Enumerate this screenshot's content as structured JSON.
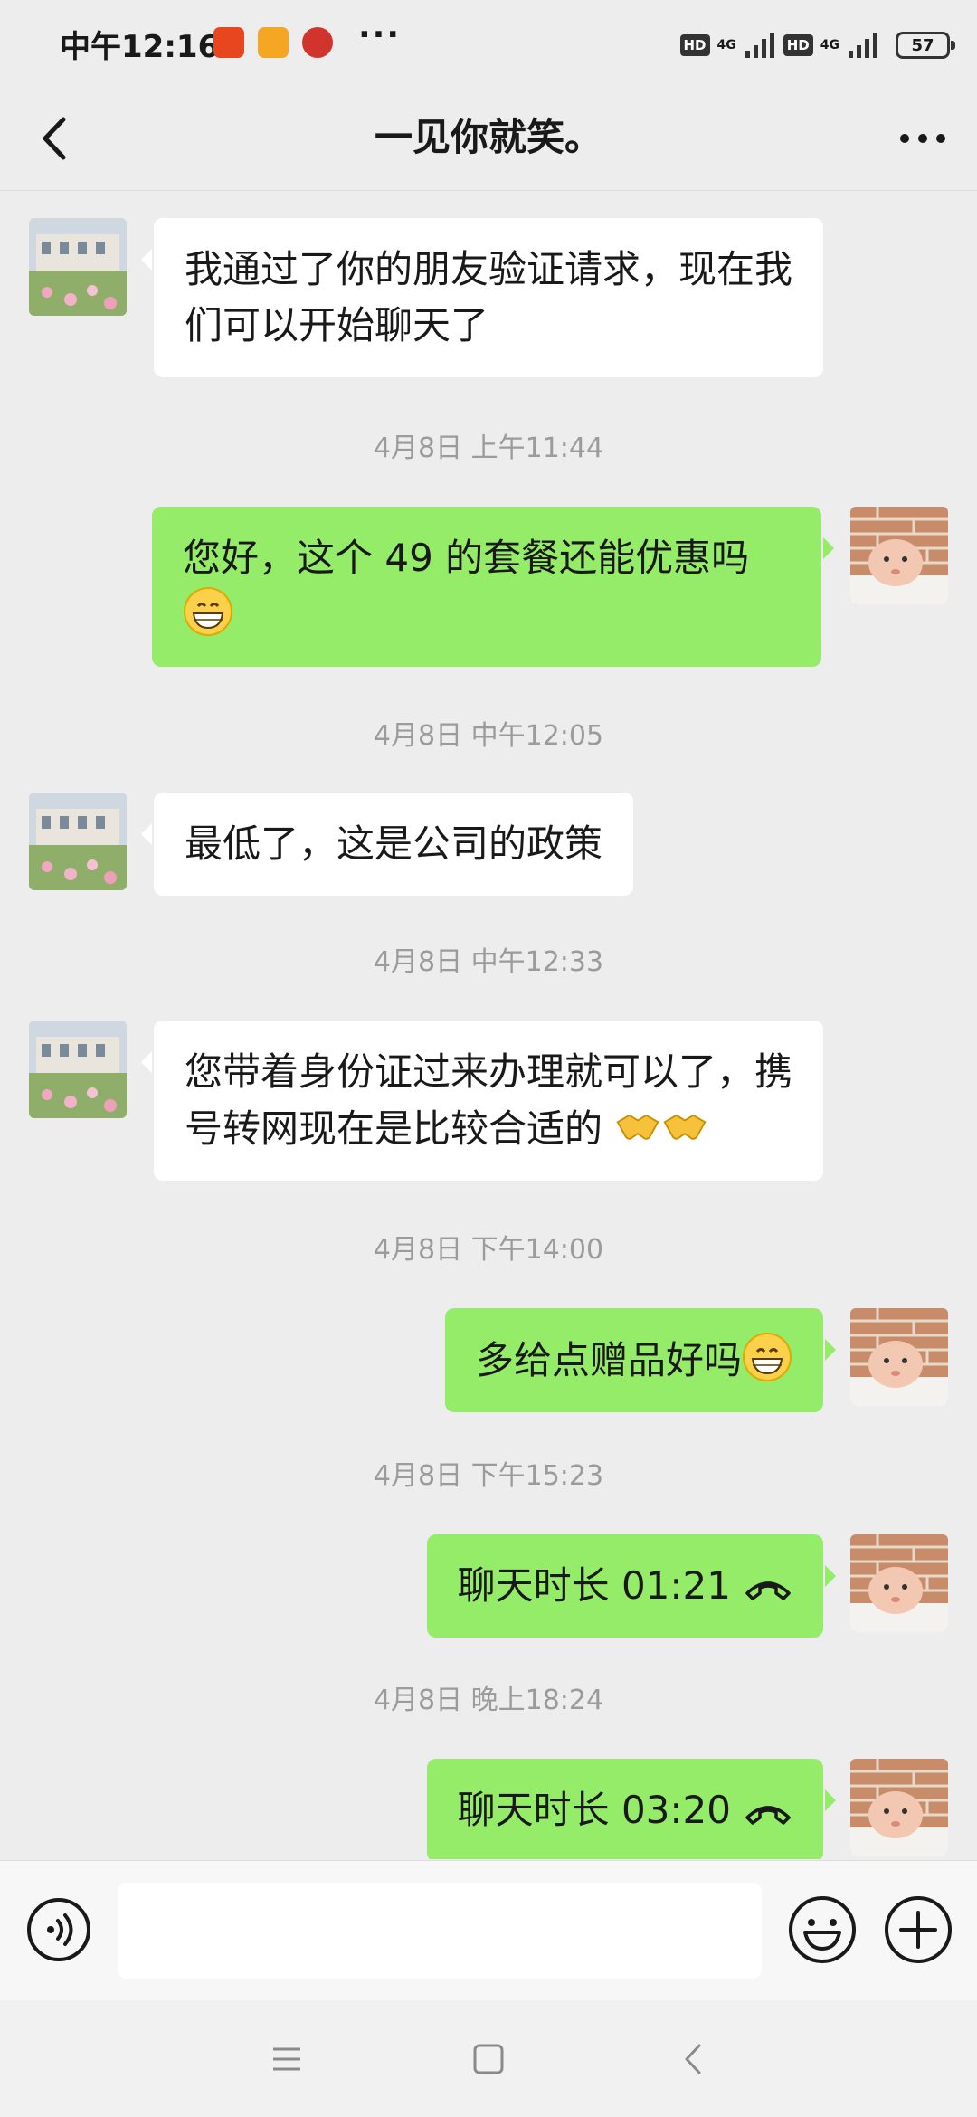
{
  "status_bar": {
    "time": "中午12:16",
    "more": "···",
    "hd1": "HD",
    "net1": "4G",
    "hd2": "HD",
    "net2": "4G",
    "battery": "57"
  },
  "header": {
    "title": "一见你就笑。"
  },
  "messages": [
    {
      "side": "in",
      "text": "我通过了你的朋友验证请求，现在我们可以开始聊天了"
    },
    {
      "type": "timestamp",
      "text": "4月8日 上午11:44"
    },
    {
      "side": "out",
      "text": "您好，这个 49 的套餐还能优惠吗",
      "emoji": "grin-emoji"
    },
    {
      "type": "timestamp",
      "text": "4月8日 中午12:05"
    },
    {
      "side": "in",
      "text": "最低了，这是公司的政策"
    },
    {
      "type": "timestamp",
      "text": "4月8日 中午12:33"
    },
    {
      "side": "in",
      "text": "您带着身份证过来办理就可以了，携号转网现在是比较合适的",
      "emoji": "handshake-emoji"
    },
    {
      "type": "timestamp",
      "text": "4月8日 下午14:00"
    },
    {
      "side": "out",
      "text": "多给点赠品好吗",
      "emoji": "grin-emoji"
    },
    {
      "type": "timestamp",
      "text": "4月8日 下午15:23"
    },
    {
      "side": "out",
      "text": "聊天时长 01:21",
      "icon": "phone-hangup-icon"
    },
    {
      "type": "timestamp",
      "text": "4月8日 晚上18:24"
    },
    {
      "side": "out",
      "text": "聊天时长 03:20",
      "icon": "phone-hangup-icon"
    }
  ],
  "colors": {
    "background": "#ededed",
    "incoming_bubble": "#ffffff",
    "outgoing_bubble": "#95ec69",
    "timestamp_text": "#9b9b9b"
  },
  "icons": {
    "back": "chevron-left-icon",
    "more": "more-dots-icon",
    "voice": "voice-icon",
    "emoji": "emoji-icon",
    "plus": "plus-icon",
    "menu": "menu-icon",
    "home": "home-icon",
    "nav_back": "back-triangle-icon"
  }
}
